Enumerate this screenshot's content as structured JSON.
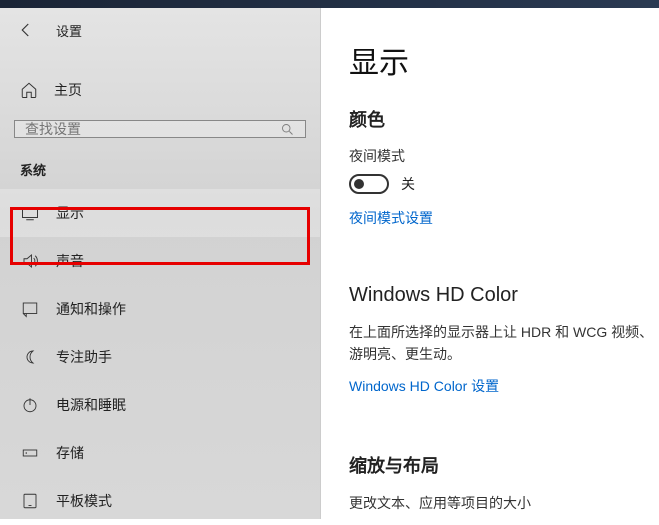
{
  "header": {
    "title": "设置"
  },
  "home": {
    "label": "主页"
  },
  "search": {
    "placeholder": "查找设置"
  },
  "section_label": "系统",
  "nav": [
    {
      "label": "显示"
    },
    {
      "label": "声音"
    },
    {
      "label": "通知和操作"
    },
    {
      "label": "专注助手"
    },
    {
      "label": "电源和睡眠"
    },
    {
      "label": "存储"
    },
    {
      "label": "平板模式"
    }
  ],
  "content": {
    "title": "显示",
    "color": {
      "heading": "颜色",
      "night_label": "夜间模式",
      "toggle_state": "关",
      "settings_link": "夜间模式设置"
    },
    "hdcolor": {
      "heading": "Windows HD Color",
      "desc": "在上面所选择的显示器上让 HDR 和 WCG 视频、游明亮、更生动。",
      "link": "Windows HD Color 设置"
    },
    "scale": {
      "heading": "缩放与布局",
      "desc": "更改文本、应用等项目的大小"
    }
  }
}
